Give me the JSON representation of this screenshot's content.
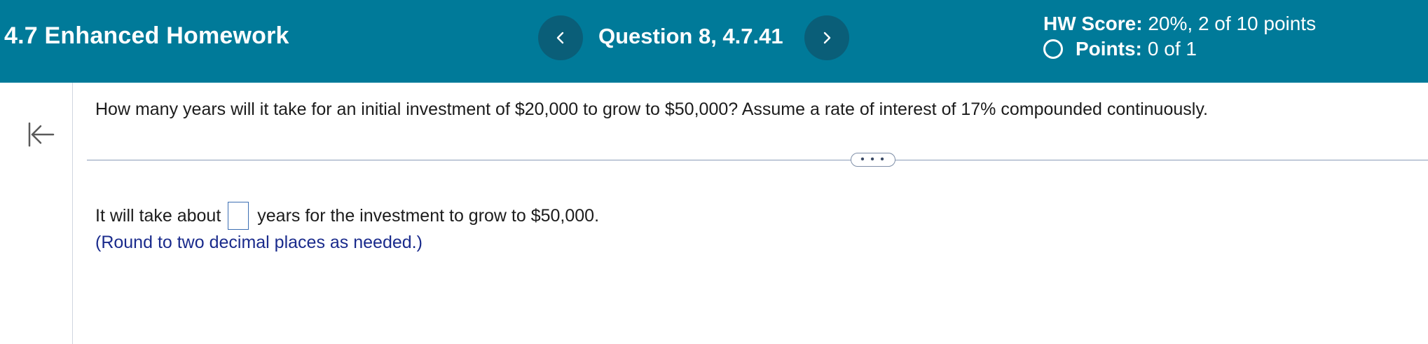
{
  "header": {
    "assignment_title": "4.7 Enhanced Homework",
    "question_title": "Question 8, 4.7.41",
    "prev_icon": "chevron-left-icon",
    "next_icon": "chevron-right-icon",
    "hw_score_label": "HW Score:",
    "hw_score_value": "20%, 2 of 10 points",
    "points_label": "Points:",
    "points_value": "0 of 1",
    "colors": {
      "header_bg": "#007a99",
      "nav_button_bg": "#0a5e78"
    }
  },
  "sidebar": {
    "collapse_icon": "collapse-left-icon"
  },
  "question": {
    "prompt": "How many years will it take for an initial investment of $20,000 to grow to $50,000?  Assume a rate of interest of 17% compounded continuously.",
    "more_label": "• • •",
    "answer_prefix": "It will take about",
    "answer_value": "",
    "answer_suffix": "years for the investment to grow to $50,000.",
    "hint": "(Round to two decimal places as needed.)"
  }
}
